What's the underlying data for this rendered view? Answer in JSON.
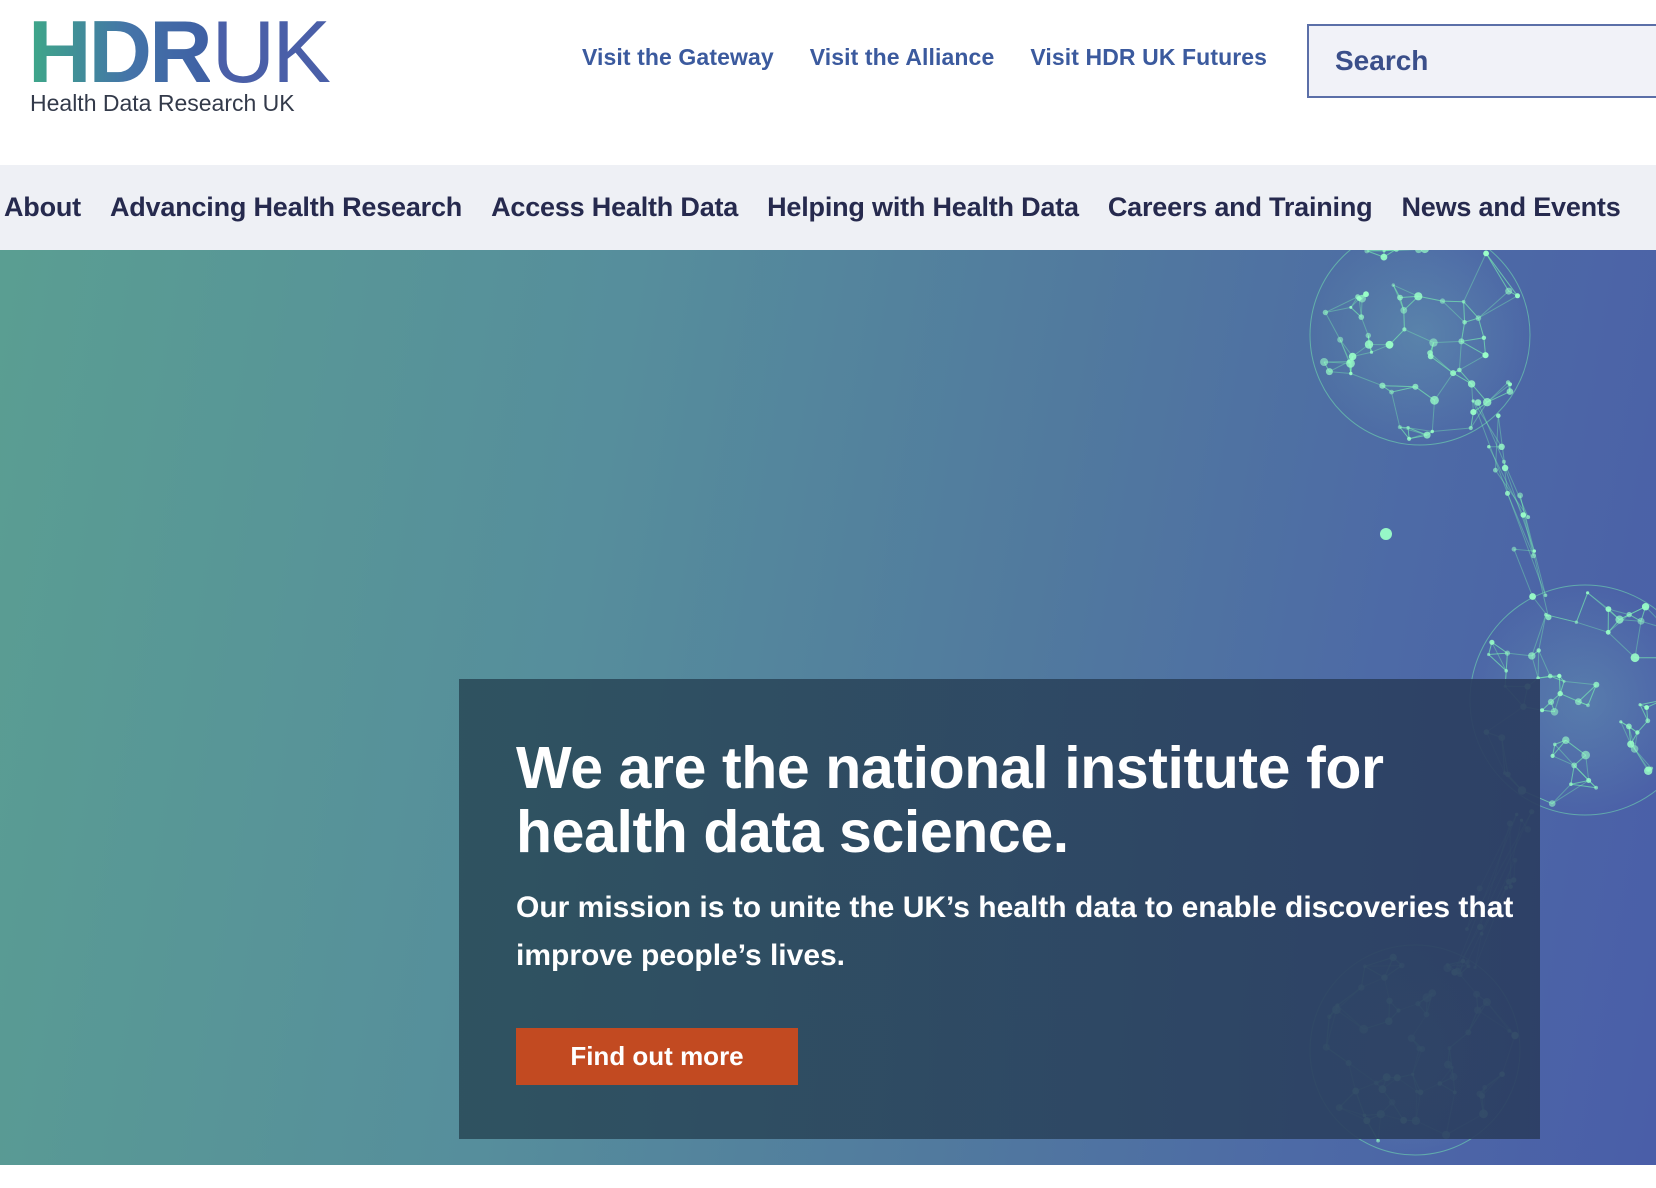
{
  "logo": {
    "mark_hdr": "HDR",
    "mark_uk": "UK",
    "subtitle": "Health Data Research UK"
  },
  "header": {
    "quick_links": [
      {
        "label": "Visit the Gateway"
      },
      {
        "label": "Visit the Alliance"
      },
      {
        "label": "Visit HDR UK Futures"
      }
    ],
    "search": {
      "placeholder": "Search",
      "value": ""
    }
  },
  "nav": {
    "items": [
      {
        "label": "About"
      },
      {
        "label": "Advancing Health Research"
      },
      {
        "label": "Access Health Data"
      },
      {
        "label": "Helping with Health Data"
      },
      {
        "label": "Careers and Training"
      },
      {
        "label": "News and Events"
      }
    ]
  },
  "hero": {
    "title": "We are the national institute for health data science.",
    "text": "Our mission is to unite the UK’s health data to enable discoveries that improve people’s lives.",
    "button_label": "Find out more",
    "image": "network-molecule-illustration"
  },
  "colors": {
    "brand_blue": "#3b5a9e",
    "nav_text": "#262a4e",
    "nav_bg": "#eef0f5",
    "cta_orange": "#c24a21",
    "hero_green": "#5a9e92",
    "hero_blue": "#4a5ea8",
    "network_green": "#7dffb4"
  }
}
